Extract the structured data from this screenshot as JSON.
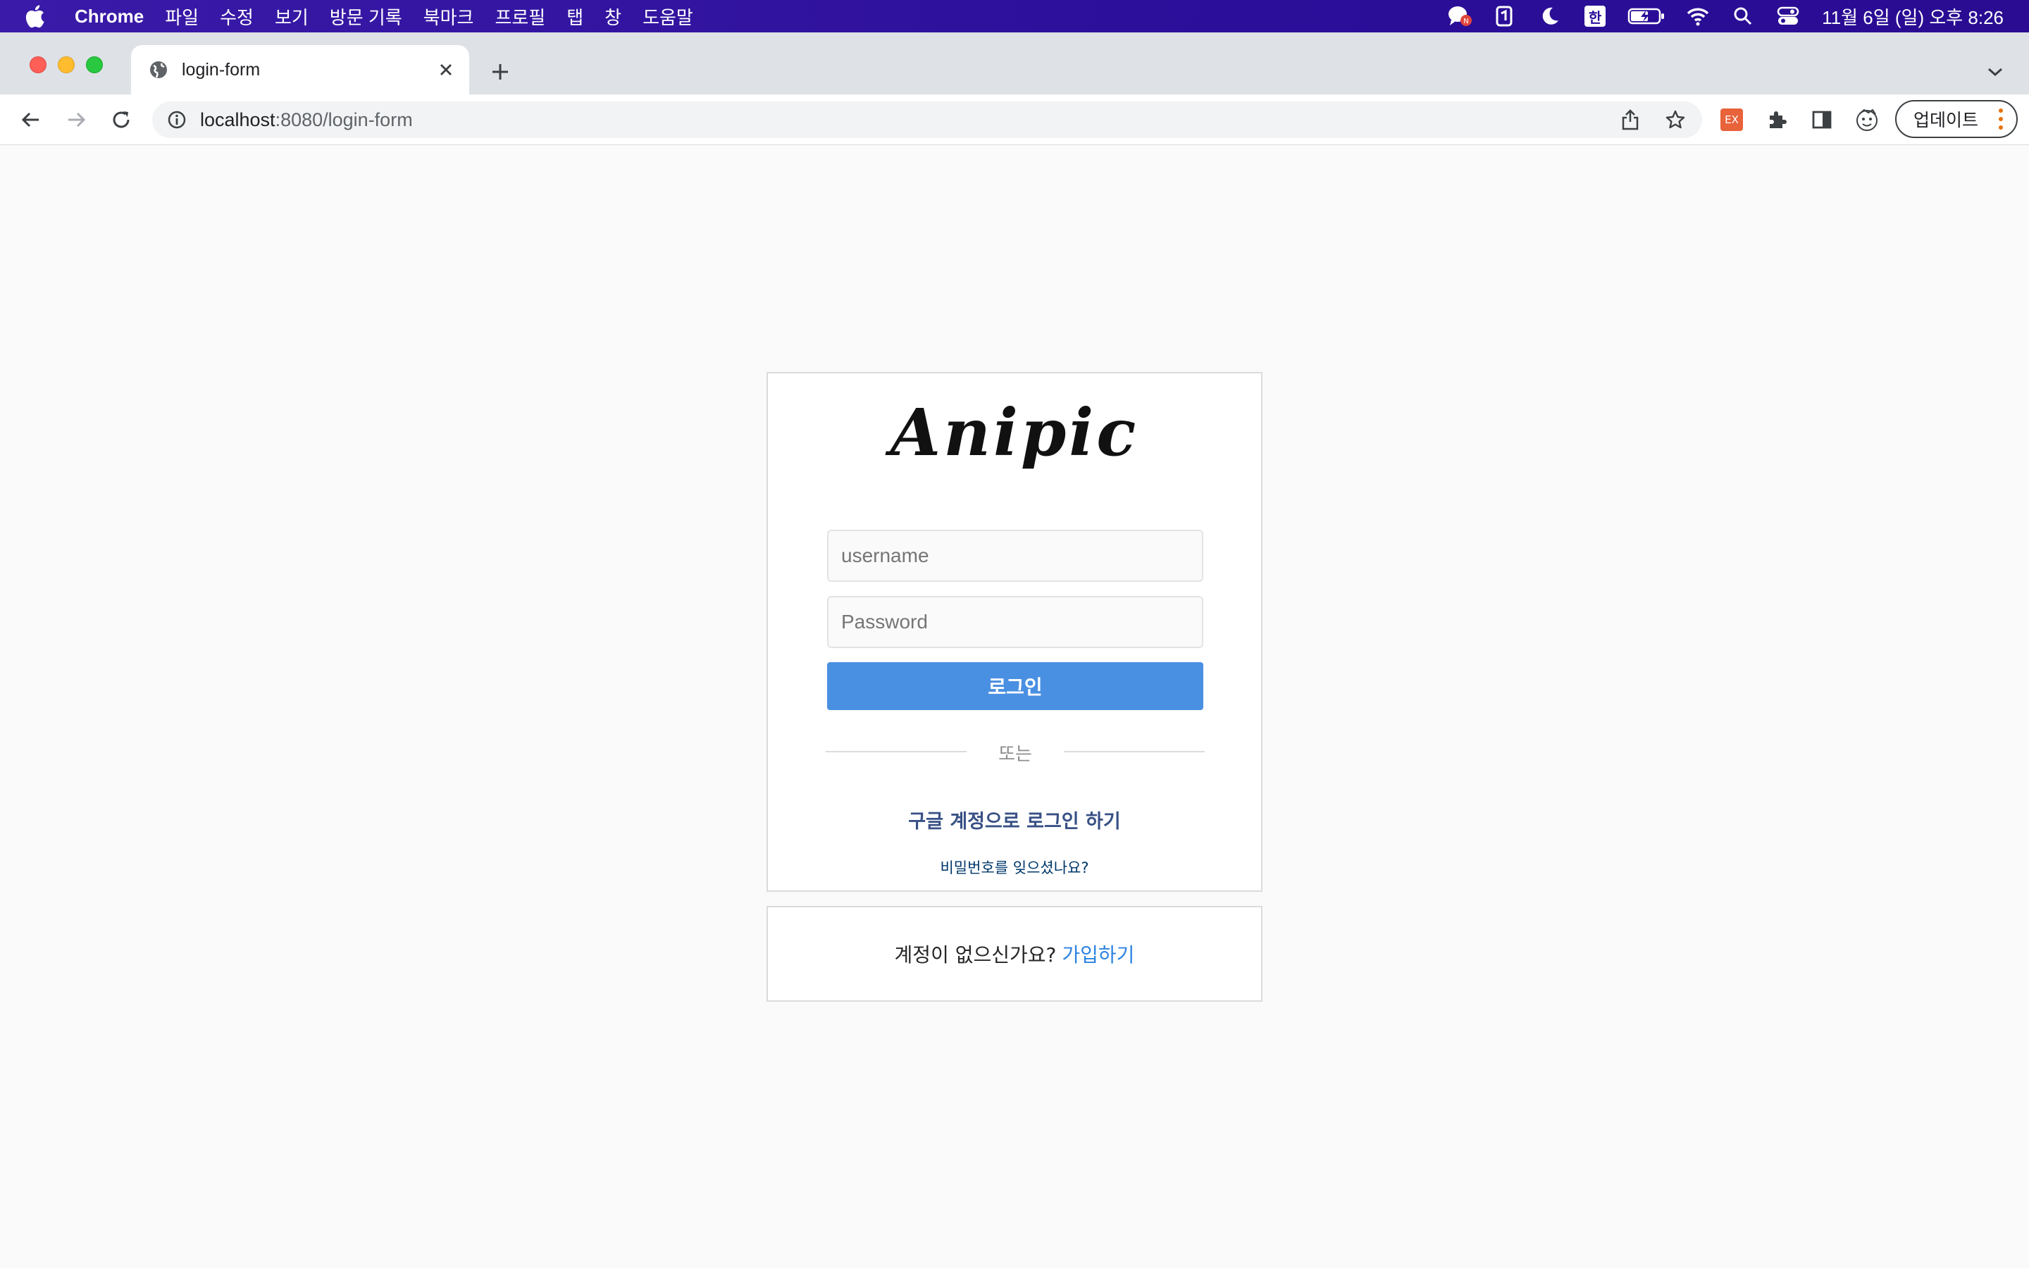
{
  "menubar": {
    "app_name": "Chrome",
    "items": [
      "파일",
      "수정",
      "보기",
      "방문 기록",
      "북마크",
      "프로필",
      "탭",
      "창",
      "도움말"
    ],
    "clock": "11월 6일 (일) 오후 8:26",
    "input_method": "한",
    "notification_badge": "N"
  },
  "tab": {
    "title": "login-form"
  },
  "toolbar": {
    "url_host": "localhost",
    "url_path": ":8080/login-form",
    "extension_badge": "EX",
    "update_label": "업데이트"
  },
  "login": {
    "logo": "Anipic",
    "username_placeholder": "username",
    "password_placeholder": "Password",
    "login_button": "로그인",
    "divider": "또는",
    "google_login": "구글 계정으로 로그인 하기",
    "forgot_password": "비밀번호를 잊으셨나요?"
  },
  "signup": {
    "prompt": "계정이 없으신가요?",
    "link": "가입하기"
  },
  "colors": {
    "menubar": "#2b0f9a",
    "primary_button": "#4a90e2",
    "google_link": "#385185",
    "signup_link": "#2b83e2",
    "page_bg": "#fafafa"
  }
}
